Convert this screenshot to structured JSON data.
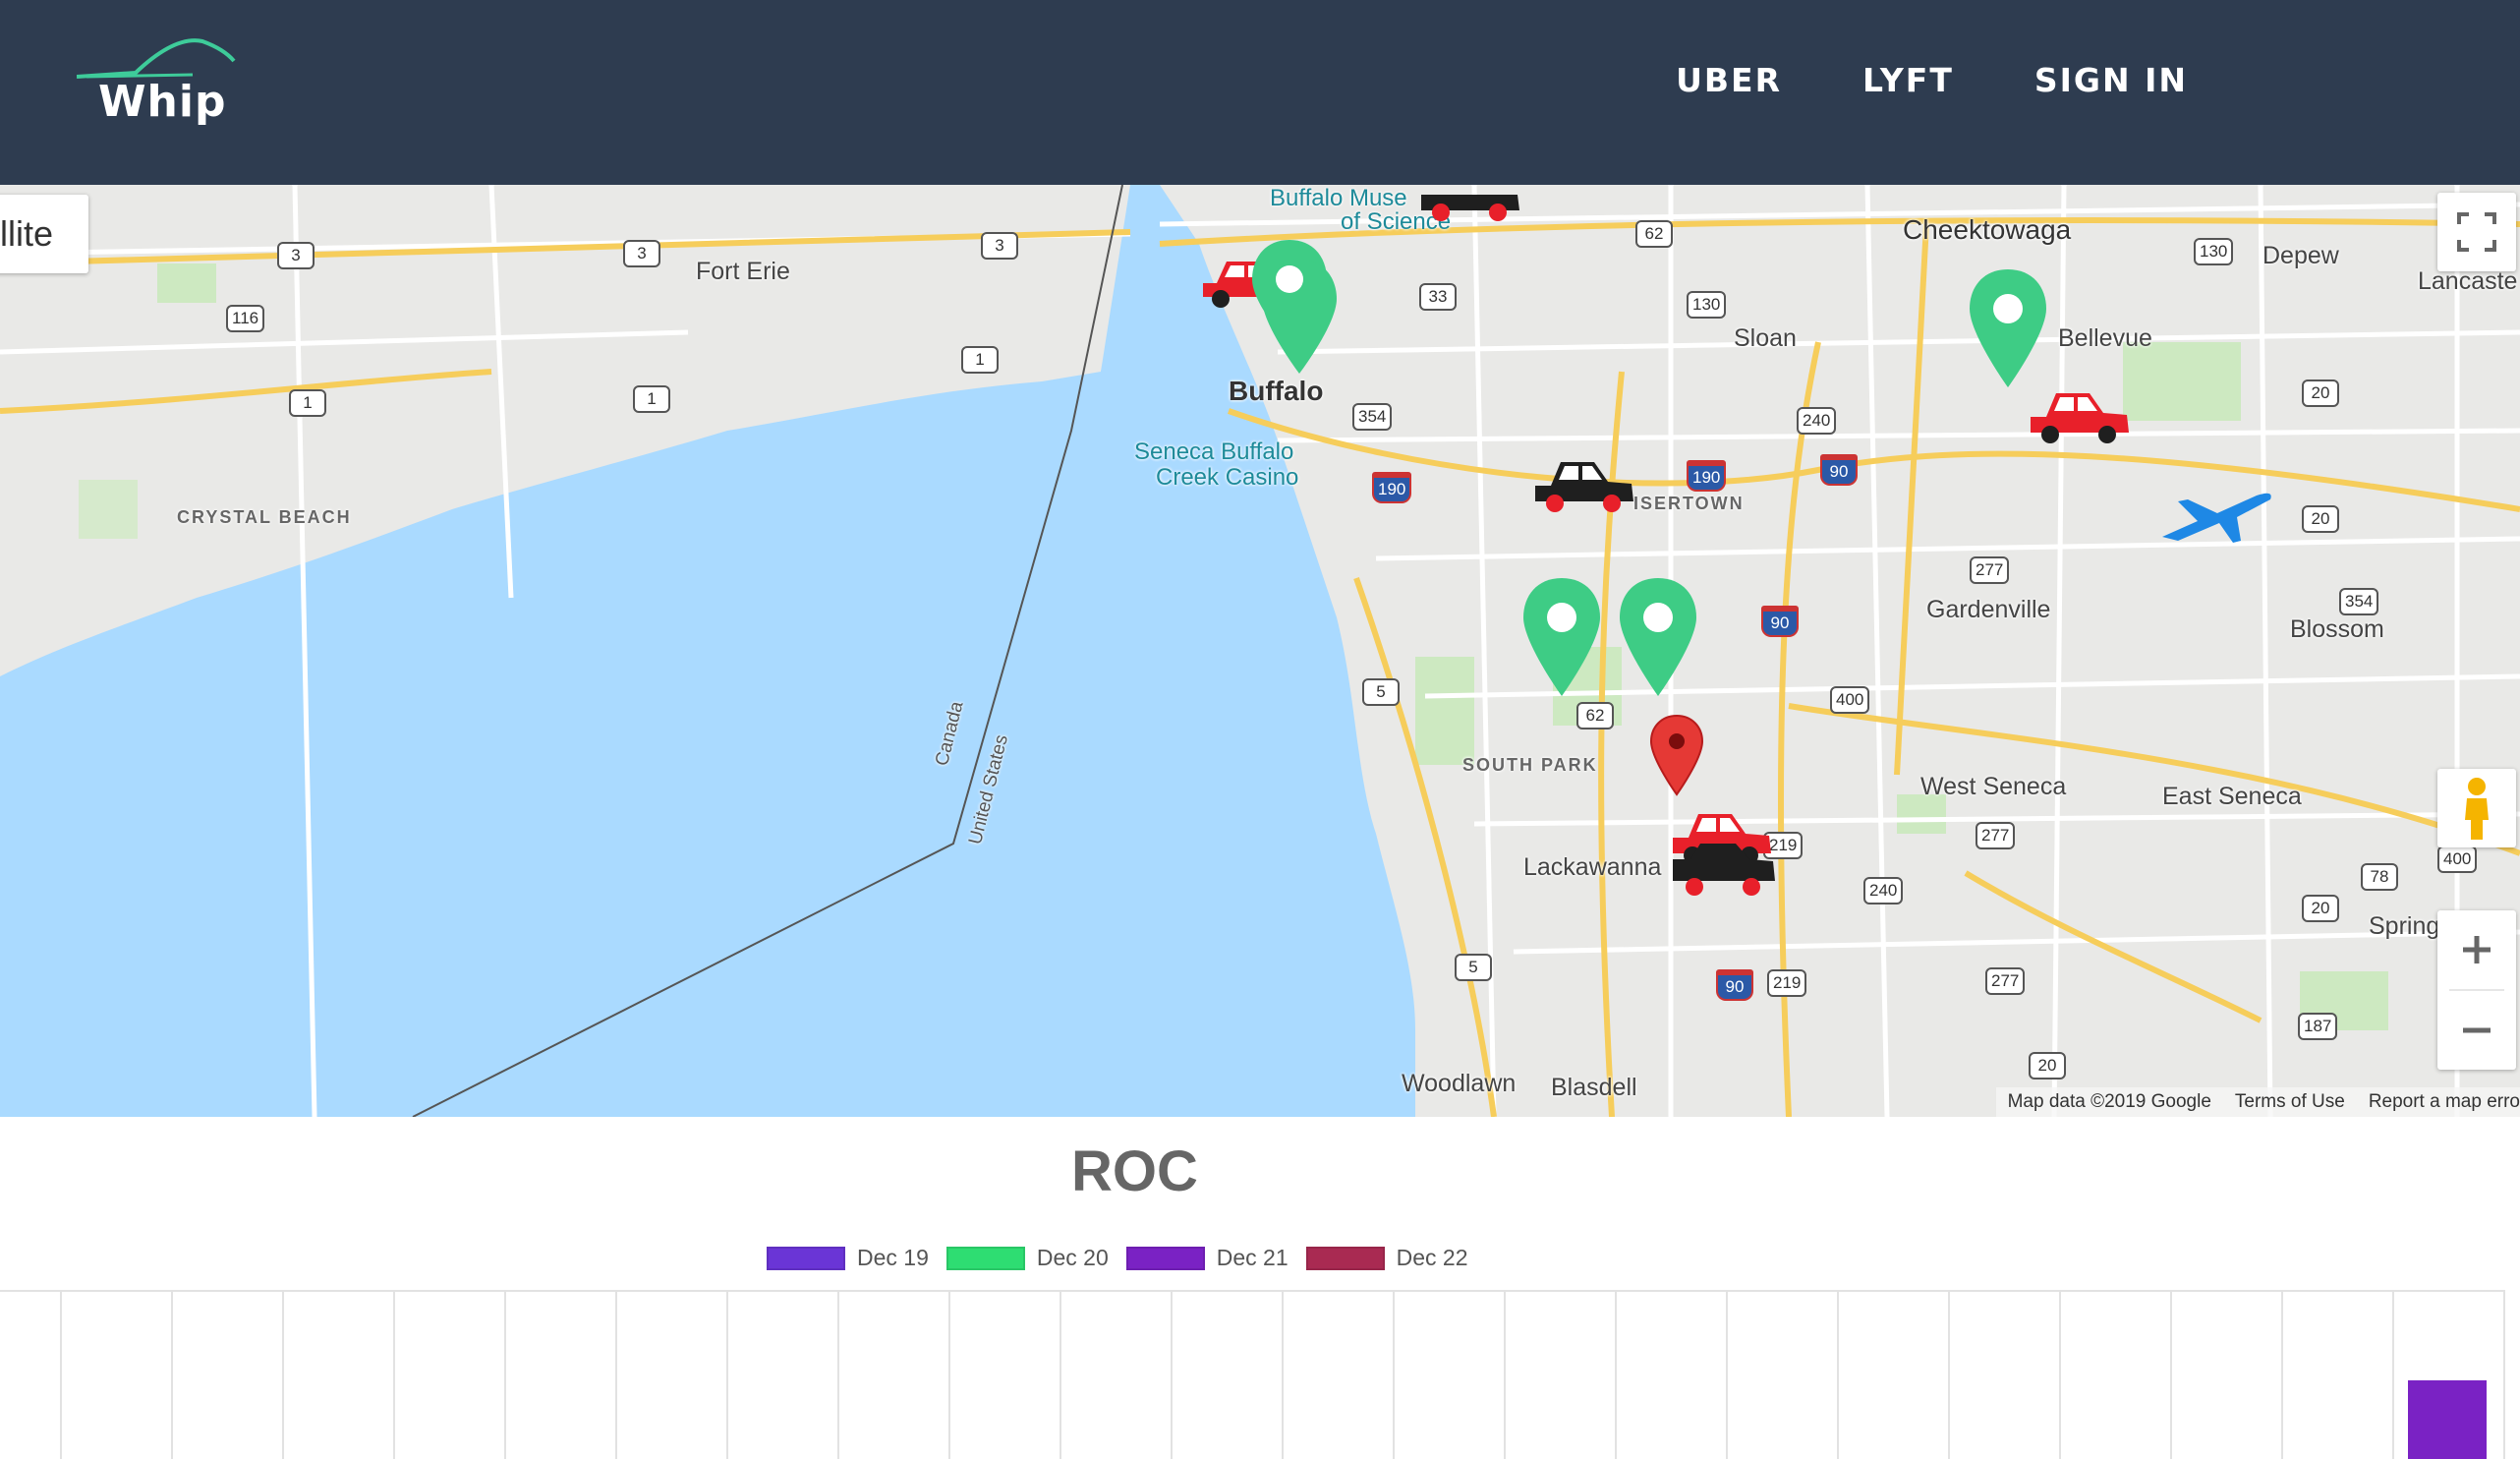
{
  "header": {
    "logo_text": "Whip",
    "nav": [
      {
        "label": "UBER"
      },
      {
        "label": "LYFT"
      },
      {
        "label": "SIGN IN"
      }
    ]
  },
  "map": {
    "map_type_button_visible_text": "llite",
    "labels": {
      "fort_erie": "Fort Erie",
      "crystal_beach": "CRYSTAL BEACH",
      "buffalo": "Buffalo",
      "museum_line1": "Buffalo Muse",
      "museum_line2": "of Science",
      "casino_line1": "Seneca Buffalo",
      "casino_line2": "Creek Casino",
      "cheektowaga": "Cheektowaga",
      "depew": "Depew",
      "lancaster": "Lancaste",
      "sloan": "Sloan",
      "bellevue": "Bellevue",
      "kaisertown": "ISERTOWN",
      "gardenville": "Gardenville",
      "blossom": "Blossom",
      "south_park": "SOUTH PARK",
      "west_seneca": "West Seneca",
      "east_seneca": "East Seneca",
      "lackawanna": "Lackawanna",
      "spring": "Spring",
      "woodlawn": "Woodlawn",
      "blasdell": "Blasdell",
      "border_canada": "Canada",
      "border_us": "United States"
    },
    "shields": {
      "s3a": "3",
      "s3b": "3",
      "s3c": "3",
      "s116": "116",
      "s1a": "1",
      "s1b": "1",
      "s1c": "1",
      "s62a": "62",
      "s62b": "62",
      "s33": "33",
      "s130a": "130",
      "s130b": "130",
      "s354a": "354",
      "s354b": "354",
      "s240a": "240",
      "s240b": "240",
      "s190a": "190",
      "s190b": "190",
      "s90a": "90",
      "s90b": "90",
      "s90c": "90",
      "s20a": "20",
      "s20b": "20",
      "s20c": "20",
      "s20d": "20",
      "s277a": "277",
      "s277b": "277",
      "s277c": "277",
      "s400a": "400",
      "s400b": "400",
      "s5a": "5",
      "s5b": "5",
      "s219a": "219",
      "s219b": "219",
      "s78": "78",
      "s187": "187"
    },
    "footer": {
      "map_data": "Map data ©2019 Google",
      "terms": "Terms of Use",
      "report": "Report a map erro"
    },
    "icons": [
      "fullscreen-icon",
      "pegman-icon",
      "zoom-in-icon",
      "zoom-out-icon",
      "car-icon",
      "location-pin-icon",
      "airplane-icon"
    ],
    "colors": {
      "pin_green": "#3ecc85",
      "pin_red": "#e53935",
      "car_red": "#e8202a",
      "car_black": "#1f1f1f",
      "plane_blue": "#1e88e5",
      "water": "#aadaff"
    }
  },
  "chart": {
    "title": "ROC",
    "legend": [
      {
        "label": "Dec 19",
        "color": "#6a35d6"
      },
      {
        "label": "Dec 20",
        "color": "#2edd72"
      },
      {
        "label": "Dec 21",
        "color": "#7a22c4"
      },
      {
        "label": "Dec 22",
        "color": "#a92a52"
      }
    ]
  },
  "chart_data": {
    "type": "bar",
    "title": "ROC",
    "series": [
      {
        "name": "Dec 19",
        "values": []
      },
      {
        "name": "Dec 20",
        "values": []
      },
      {
        "name": "Dec 21",
        "values": []
      },
      {
        "name": "Dec 22",
        "values": []
      }
    ],
    "legend_position": "top-center",
    "grid": true
  }
}
